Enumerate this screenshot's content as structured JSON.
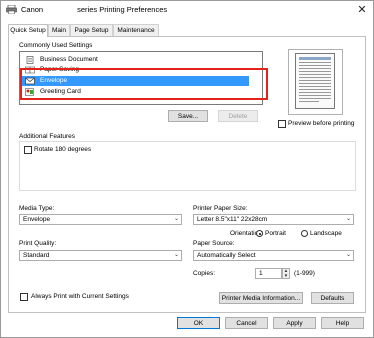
{
  "window": {
    "title": "Canon series Printing Preferences",
    "title_prefix": "Canon",
    "title_suffix": "series Printing Preferences",
    "close_glyph": "✕"
  },
  "tabs": [
    {
      "label": "Quick Setup",
      "active": true
    },
    {
      "label": "Main",
      "active": false
    },
    {
      "label": "Page Setup",
      "active": false
    },
    {
      "label": "Maintenance",
      "active": false
    }
  ],
  "commonly_used": {
    "label": "Commonly Used Settings",
    "items": [
      {
        "label": "Business Document",
        "icon": "document-icon",
        "selected": false
      },
      {
        "label": "Paper Saving",
        "icon": "paper-saving-icon",
        "selected": false
      },
      {
        "label": "Envelope",
        "icon": "envelope-icon",
        "selected": true
      },
      {
        "label": "Greeting Card",
        "icon": "greeting-card-icon",
        "selected": false
      }
    ],
    "save_button": "Save...",
    "delete_button": "Delete"
  },
  "preview": {
    "checkbox_label": "Preview before printing",
    "checked": false
  },
  "additional_features": {
    "label": "Additional Features",
    "rotate_label": "Rotate 180 degrees",
    "rotate_checked": false
  },
  "media_type": {
    "label": "Media Type:",
    "value": "Envelope"
  },
  "printer_paper_size": {
    "label": "Printer Paper Size:",
    "value": "Letter 8.5\"x11\" 22x28cm"
  },
  "orientation": {
    "label": "Orientation:",
    "options": [
      {
        "label": "Portrait",
        "selected": true
      },
      {
        "label": "Landscape",
        "selected": false
      }
    ]
  },
  "print_quality": {
    "label": "Print Quality:",
    "value": "Standard"
  },
  "paper_source": {
    "label": "Paper Source:",
    "value": "Automatically Select"
  },
  "copies": {
    "label": "Copies:",
    "value": "1",
    "range": "(1-999)"
  },
  "always_print": {
    "label": "Always Print with Current Settings",
    "checked": false
  },
  "buttons": {
    "printer_media_info": "Printer Media Information...",
    "defaults": "Defaults",
    "ok": "OK",
    "cancel": "Cancel",
    "apply": "Apply",
    "help": "Help"
  },
  "colors": {
    "selection": "#3399ff",
    "highlight_frame": "#e2231a",
    "default_button_border": "#0078d7"
  }
}
